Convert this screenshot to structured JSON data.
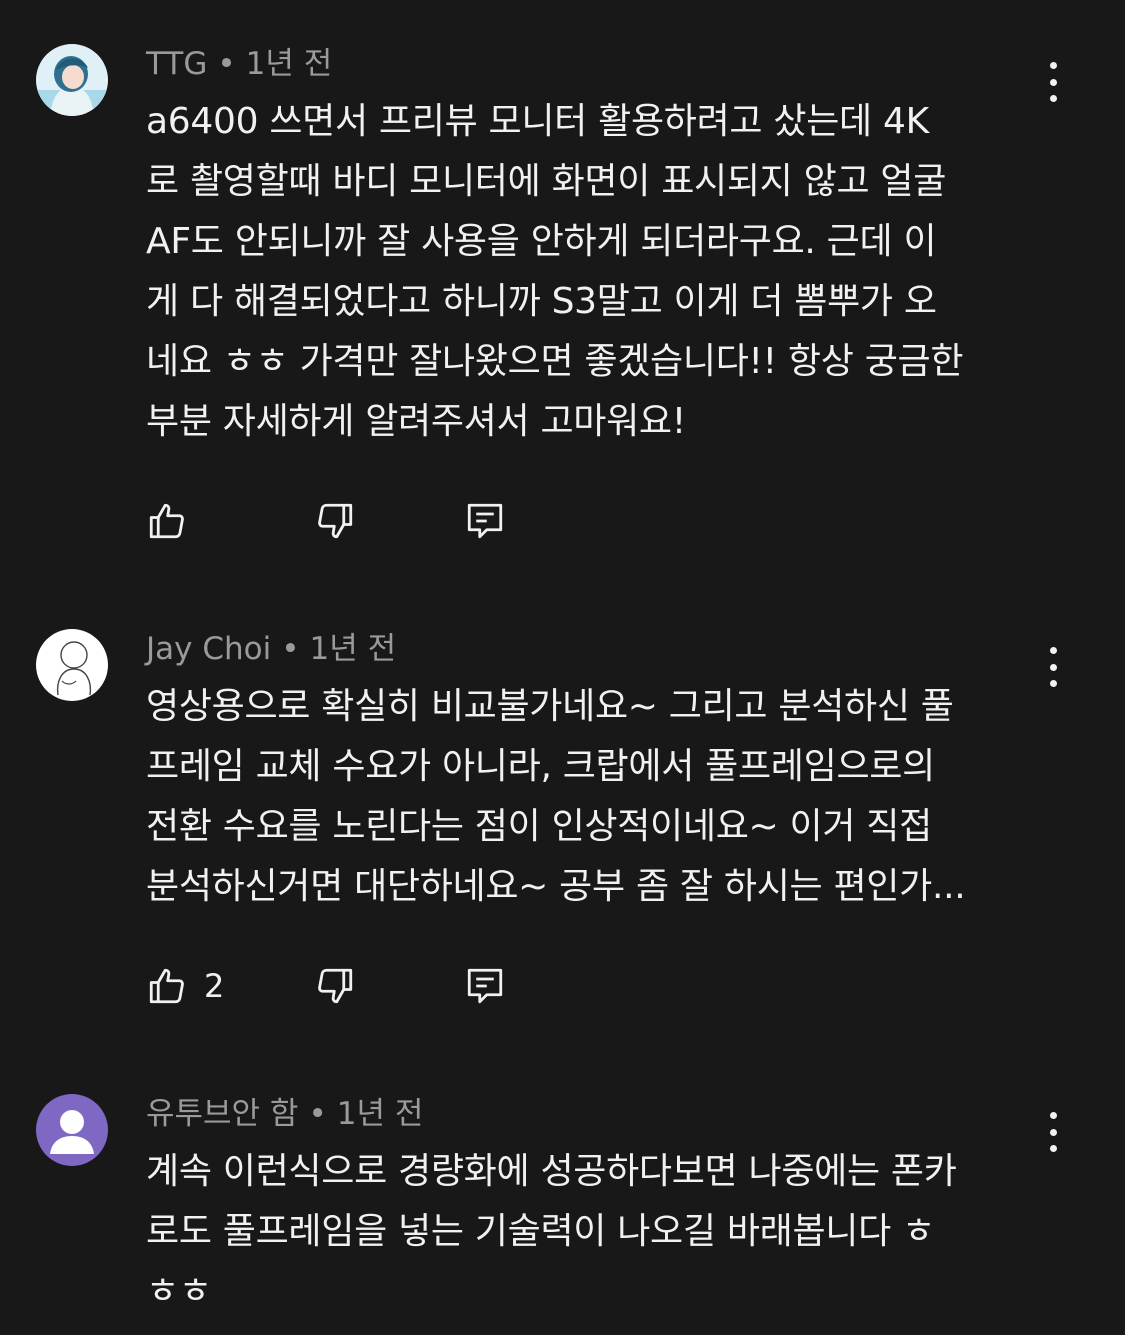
{
  "comments": [
    {
      "author": "TTG",
      "time": "1년 전",
      "text": "a6400 쓰면서 프리뷰 모니터 활용하려고 샀는데 4K\n로 촬영할때 바디 모니터에 화면이 표시되지 않고 얼굴\nAF도 안되니까 잘 사용을 안하게 되더라구요. 근데 이\n게 다 해결되었다고 하니까 S3말고 이게 더 뽐뿌가 오\n네요 ㅎㅎ 가격만 잘나왔으면 좋겠습니다!! 항상 궁금한\n부분 자세하게 알려주셔서 고마워요!",
      "likes": ""
    },
    {
      "author": "Jay Choi",
      "time": "1년 전",
      "text": "영상용으로 확실히 비교불가네요~ 그리고 분석하신 풀\n프레임 교체 수요가 아니라, 크랍에서 풀프레임으로의\n전환 수요를 노린다는 점이 인상적이네요~ 이거 직접\n분석하신거면 대단하네요~ 공부 좀 잘 하시는 편인가...",
      "likes": "2"
    },
    {
      "author": "유투브안 함",
      "time": "1년 전",
      "text": "계속 이런식으로 경량화에 성공하다보면 나중에는 폰카\n로도 풀프레임을 넣는 기술력이 나오길 바래봅니다 ㅎ\nㅎㅎ",
      "likes": ""
    }
  ],
  "meta_separator": "•",
  "icons": {
    "like": "thumbs-up-icon",
    "dislike": "thumbs-down-icon",
    "reply": "reply-comment-icon",
    "more": "more-vertical-icon"
  },
  "colors": {
    "background": "#181818",
    "text": "#f1f1f1",
    "meta": "#9a9a9a",
    "default_avatar": "#7e68c4"
  }
}
